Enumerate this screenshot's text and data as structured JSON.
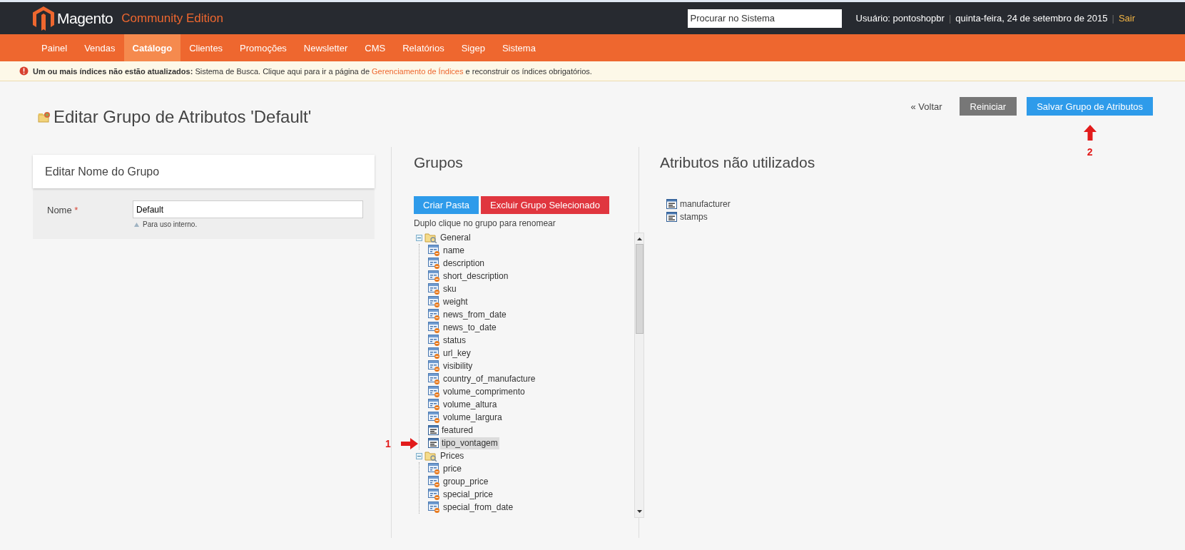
{
  "header": {
    "logo_text": "Magento",
    "edition": "Community Edition",
    "search": {
      "placeholder": "Procurar no Sistema"
    },
    "user": "Usuário: pontoshopbr",
    "date": "quinta-feira, 24 de setembro de 2015",
    "separators": [
      "|",
      "|"
    ],
    "logout": "Sair"
  },
  "nav": [
    {
      "label": "Painel",
      "selected": false
    },
    {
      "label": "Vendas",
      "selected": false
    },
    {
      "label": "Catálogo",
      "selected": true
    },
    {
      "label": "Clientes",
      "selected": false
    },
    {
      "label": "Promoções",
      "selected": false
    },
    {
      "label": "Newsletter",
      "selected": false
    },
    {
      "label": "CMS",
      "selected": false
    },
    {
      "label": "Relatórios",
      "selected": false
    },
    {
      "label": "Sigep",
      "selected": false
    },
    {
      "label": "Sistema",
      "selected": false
    }
  ],
  "notice": {
    "text": "**Um ou mais índices não estão atualizados:** Sistema de Busca. Clique aqui para ir a página de",
    "link": "Gerenciamento de Índices",
    "after": "e reconstruir os índices obrigatórios."
  },
  "page_title": "Editar Grupo de Atributos 'Default'",
  "actions": {
    "back": "« Voltar",
    "reset": "Reiniciar",
    "save": "Salvar Grupo de Atributos"
  },
  "group_name_panel": {
    "title": "Editar Nome do Grupo",
    "label": "Nome",
    "required": "*",
    "value": "Default",
    "hint": "Para uso interno."
  },
  "groups": {
    "heading": "Grupos",
    "create_button": "Criar Pasta",
    "delete_button": "Excluir Grupo Selecionado",
    "hint": "Duplo clique no grupo para renomear",
    "tree": [
      {
        "label": "General",
        "expanded": true,
        "children": [
          {
            "label": "name",
            "kind": "system",
            "selected": false
          },
          {
            "label": "description",
            "kind": "system",
            "selected": false
          },
          {
            "label": "short_description",
            "kind": "system",
            "selected": false
          },
          {
            "label": "sku",
            "kind": "system",
            "selected": false
          },
          {
            "label": "weight",
            "kind": "system",
            "selected": false
          },
          {
            "label": "news_from_date",
            "kind": "system",
            "selected": false
          },
          {
            "label": "news_to_date",
            "kind": "system",
            "selected": false
          },
          {
            "label": "status",
            "kind": "system",
            "selected": false
          },
          {
            "label": "url_key",
            "kind": "system",
            "selected": false
          },
          {
            "label": "visibility",
            "kind": "system",
            "selected": false
          },
          {
            "label": "country_of_manufacture",
            "kind": "system",
            "selected": false
          },
          {
            "label": "volume_comprimento",
            "kind": "system",
            "selected": false
          },
          {
            "label": "volume_altura",
            "kind": "system",
            "selected": false
          },
          {
            "label": "volume_largura",
            "kind": "system",
            "selected": false
          },
          {
            "label": "featured",
            "kind": "user",
            "selected": false
          },
          {
            "label": "tipo_vontagem",
            "kind": "user",
            "selected": true
          }
        ]
      },
      {
        "label": "Prices",
        "expanded": true,
        "children": [
          {
            "label": "price",
            "kind": "system",
            "selected": false
          },
          {
            "label": "group_price",
            "kind": "system",
            "selected": false
          },
          {
            "label": "special_price",
            "kind": "system",
            "selected": false
          },
          {
            "label": "special_from_date",
            "kind": "system",
            "selected": false
          }
        ]
      }
    ]
  },
  "unused": {
    "heading": "Atributos não utilizados",
    "items": [
      {
        "label": "manufacturer",
        "kind": "user"
      },
      {
        "label": "stamps",
        "kind": "user"
      }
    ]
  },
  "annotations": [
    {
      "label": "1",
      "kind": "arrow-right"
    },
    {
      "label": "2",
      "kind": "arrow-up"
    }
  ]
}
